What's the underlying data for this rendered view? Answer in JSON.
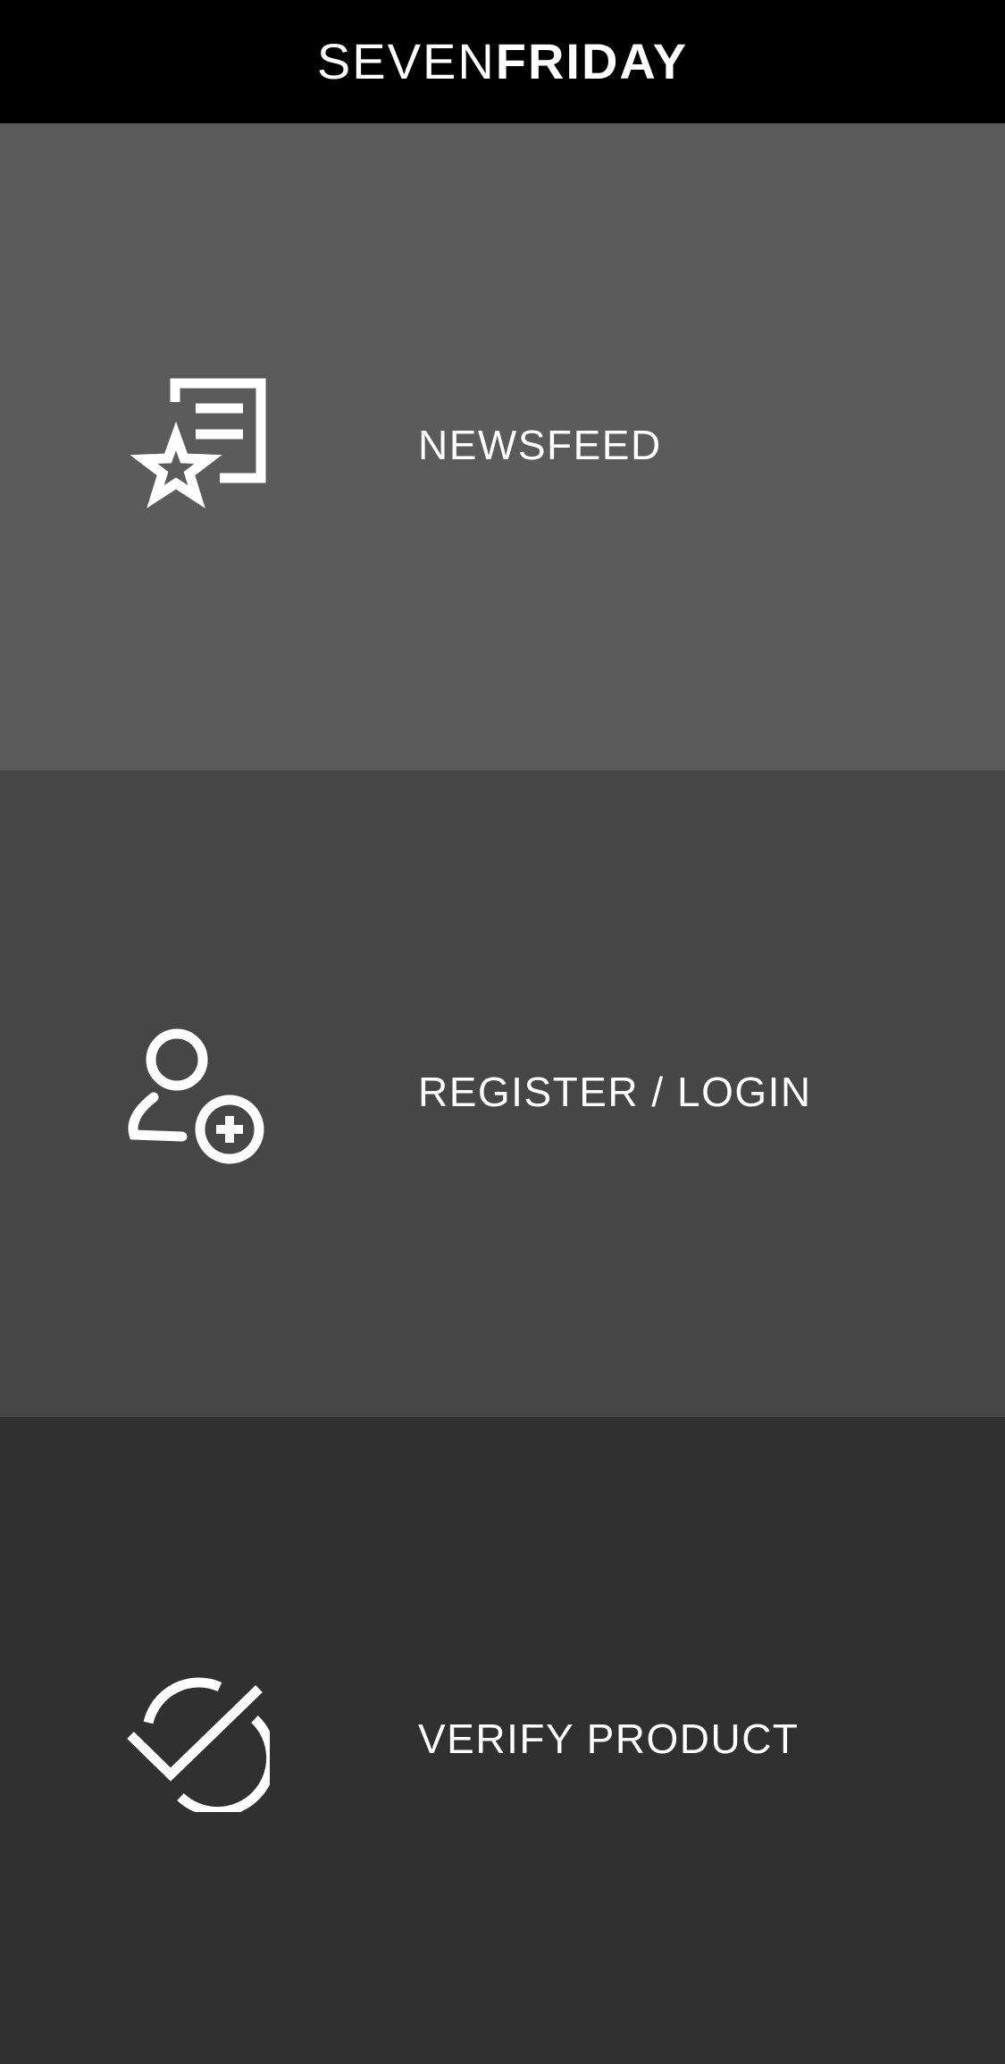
{
  "header": {
    "logo_light": "SEVEN",
    "logo_bold": "FRIDAY",
    "background": "#000000"
  },
  "menu": {
    "items": [
      {
        "label": "NEWSFEED",
        "icon": "newsfeed-star-document-icon",
        "background": "#5b5b5b"
      },
      {
        "label": "REGISTER / LOGIN",
        "icon": "user-add-icon",
        "background": "#464646"
      },
      {
        "label": "VERIFY PRODUCT",
        "icon": "verify-check-icon",
        "background": "#303030"
      }
    ]
  },
  "colors": {
    "text": "#ffffff"
  }
}
